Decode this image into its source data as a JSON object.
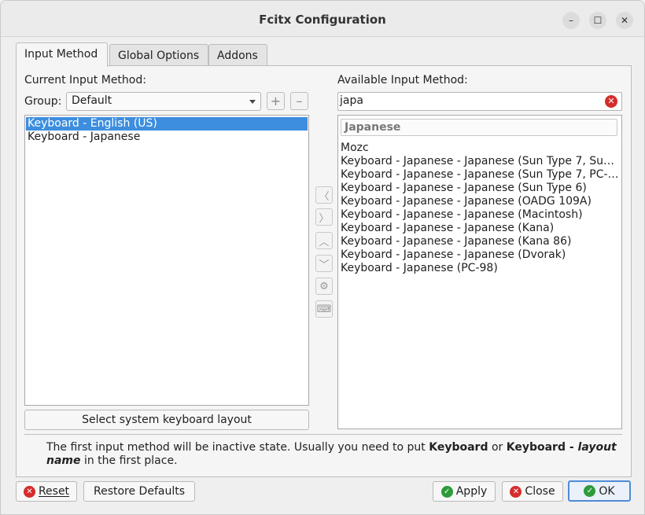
{
  "window": {
    "title": "Fcitx Configuration",
    "controls": {
      "minimize": "–",
      "maximize": "☐",
      "close": "✕"
    }
  },
  "tabs": [
    {
      "label": "Input Method",
      "active": true
    },
    {
      "label": "Global Options",
      "active": false
    },
    {
      "label": "Addons",
      "active": false
    }
  ],
  "left": {
    "heading": "Current Input Method:",
    "group_label": "Group:",
    "group_value": "Default",
    "add_symbol": "+",
    "remove_symbol": "–",
    "items": [
      "Keyboard - English (US)",
      "Keyboard - Japanese"
    ],
    "selected_index": 0,
    "layout_button": "Select system keyboard layout"
  },
  "right": {
    "heading": "Available Input Method:",
    "search_value": "japa",
    "group_header": "Japanese",
    "items": [
      "Mozc",
      "Keyboard - Japanese - Japanese (Sun Type 7, Sun-…",
      "Keyboard - Japanese - Japanese (Sun Type 7, PC-c…",
      "Keyboard - Japanese - Japanese (Sun Type 6)",
      "Keyboard - Japanese - Japanese (OADG 109A)",
      "Keyboard - Japanese - Japanese (Macintosh)",
      "Keyboard - Japanese - Japanese (Kana)",
      "Keyboard - Japanese - Japanese (Kana 86)",
      "Keyboard - Japanese - Japanese (Dvorak)",
      "Keyboard - Japanese (PC-98)"
    ]
  },
  "middle_buttons": {
    "left_arrow": "〈",
    "right_arrow": "〉",
    "up": "︿",
    "down": "﹀",
    "configure": "⚙",
    "keyboard": "⌨"
  },
  "hint": {
    "part1": "The first input method will be inactive state. Usually you need to put ",
    "bold1": "Keyboard",
    "part2": " or ",
    "bold2": "Keyboard - ",
    "italic": "layout name",
    "part3": " in the first place."
  },
  "footer": {
    "reset": "Reset",
    "restore": "Restore Defaults",
    "apply": "Apply",
    "close": "Close",
    "ok": "OK",
    "cross": "✕",
    "check": "✓"
  }
}
